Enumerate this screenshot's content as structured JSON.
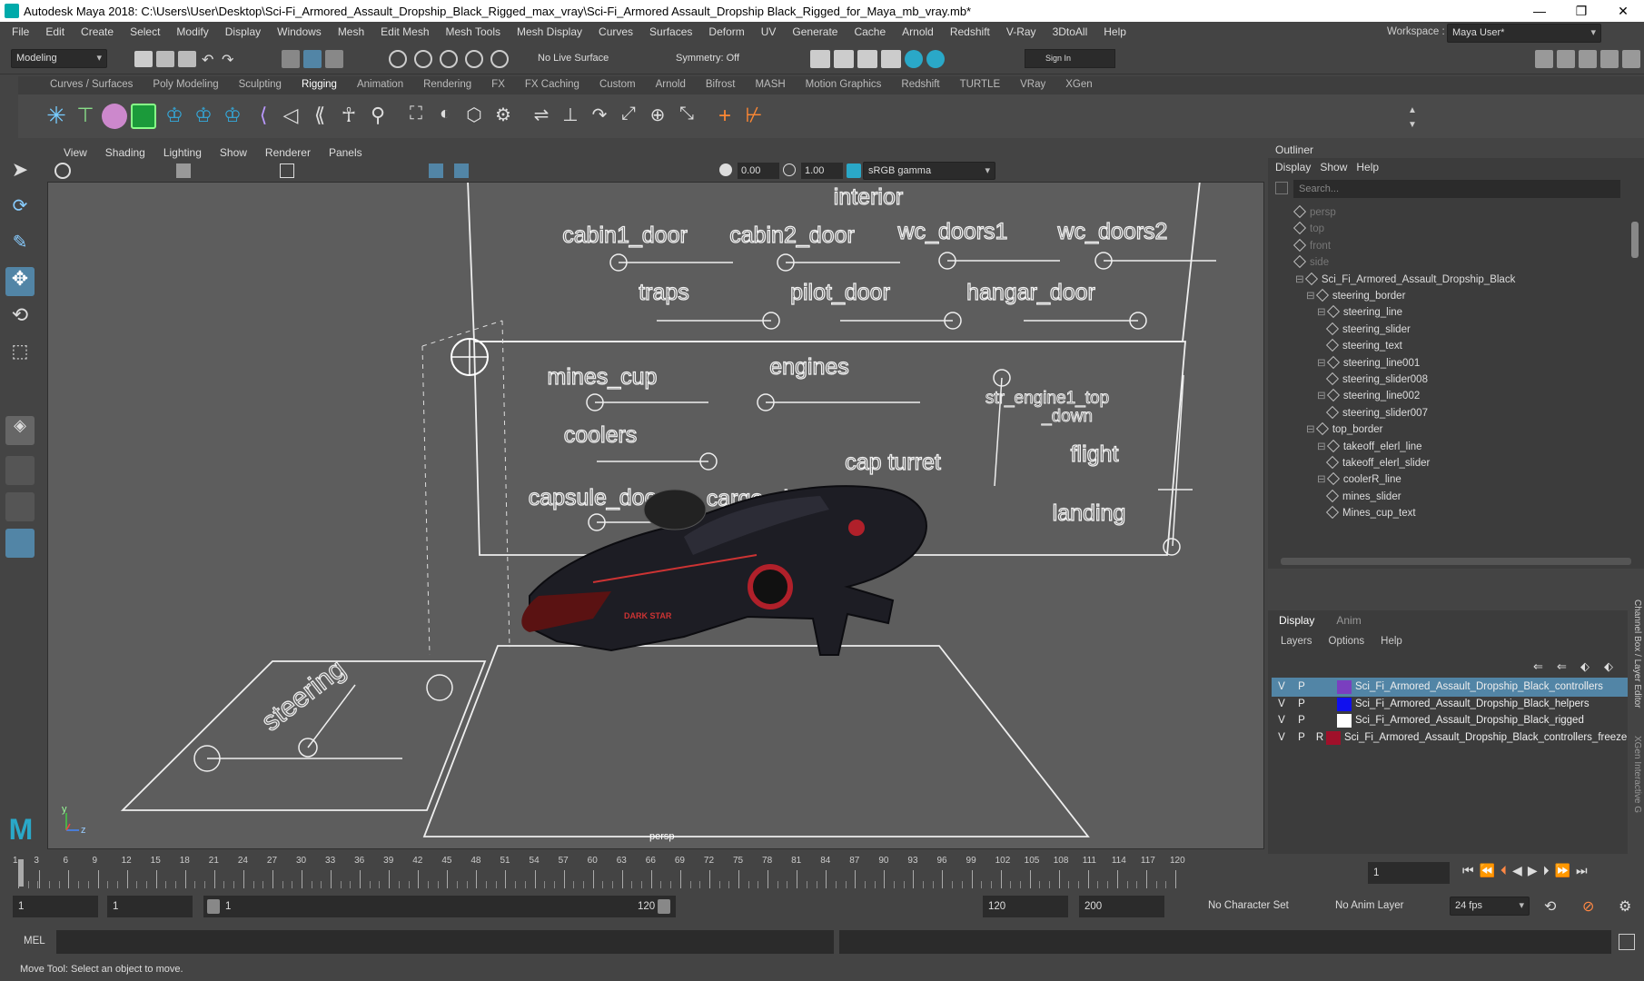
{
  "window": {
    "title": "Autodesk Maya 2018: C:\\Users\\User\\Desktop\\Sci-Fi_Armored_Assault_Dropship_Black_Rigged_max_vray\\Sci-Fi_Armored Assault_Dropship Black_Rigged_for_Maya_mb_vray.mb*",
    "minimize": "—",
    "maximize": "❐",
    "close": "✕"
  },
  "menubar": [
    "File",
    "Edit",
    "Create",
    "Select",
    "Modify",
    "Display",
    "Windows",
    "Mesh",
    "Edit Mesh",
    "Mesh Tools",
    "Mesh Display",
    "Curves",
    "Surfaces",
    "Deform",
    "UV",
    "Generate",
    "Cache",
    "Arnold",
    "Redshift",
    "V-Ray",
    "3DtoAll",
    "Help"
  ],
  "workspace": {
    "label": "Workspace :",
    "value": "Maya User*"
  },
  "statusline": {
    "mode": "Modeling",
    "live_surface": "No Live Surface",
    "symmetry": "Symmetry: Off",
    "sign_in": "Sign In"
  },
  "shelf_tabs": [
    "Curves / Surfaces",
    "Poly Modeling",
    "Sculpting",
    "Rigging",
    "Animation",
    "Rendering",
    "FX",
    "FX Caching",
    "Custom",
    "Arnold",
    "Bifrost",
    "MASH",
    "Motion Graphics",
    "Redshift",
    "TURTLE",
    "VRay",
    "XGen"
  ],
  "active_shelf": "Rigging",
  "viewport": {
    "menus": [
      "View",
      "Shading",
      "Lighting",
      "Show",
      "Renderer",
      "Panels"
    ],
    "exposure": "0.00",
    "gamma": "1.00",
    "color_space": "sRGB gamma",
    "camera_label": "persp",
    "axis_y": "y",
    "axis_z": "z",
    "labels": {
      "interior": "interior",
      "cabin1_door": "cabin1_door",
      "cabin2_door": "cabin2_door",
      "wc_doors1": "wc_doors1",
      "wc_doors2": "wc_doors2",
      "traps": "traps",
      "pilot_door": "pilot_door",
      "hangar_door": "hangar_door",
      "mines_cup": "mines_cup",
      "engines": "engines",
      "coolers": "coolers",
      "capsule_doors": "capsule_doors",
      "cargo_door": "cargo_door",
      "cap_turret": "cap turret",
      "engine_top": "str_engine1_top",
      "engine_top2": "_down",
      "flight": "flight",
      "landing": "landing",
      "steering": "steering",
      "ship_decal": "DARK STAR"
    }
  },
  "outliner": {
    "title": "Outliner",
    "menus": [
      "Display",
      "Show",
      "Help"
    ],
    "search_placeholder": "Search...",
    "items": [
      {
        "label": "persp",
        "dim": true,
        "indent": 0
      },
      {
        "label": "top",
        "dim": true,
        "indent": 0
      },
      {
        "label": "front",
        "dim": true,
        "indent": 0
      },
      {
        "label": "side",
        "dim": true,
        "indent": 0
      },
      {
        "label": "Sci_Fi_Armored_Assault_Dropship_Black",
        "dim": false,
        "indent": 0
      },
      {
        "label": "steering_border",
        "dim": false,
        "indent": 1
      },
      {
        "label": "steering_line",
        "dim": false,
        "indent": 2
      },
      {
        "label": "steering_slider",
        "dim": false,
        "indent": 3
      },
      {
        "label": "steering_text",
        "dim": false,
        "indent": 3
      },
      {
        "label": "steering_line001",
        "dim": false,
        "indent": 2
      },
      {
        "label": "steering_slider008",
        "dim": false,
        "indent": 3
      },
      {
        "label": "steering_line002",
        "dim": false,
        "indent": 2
      },
      {
        "label": "steering_slider007",
        "dim": false,
        "indent": 3
      },
      {
        "label": "top_border",
        "dim": false,
        "indent": 1
      },
      {
        "label": "takeoff_elerl_line",
        "dim": false,
        "indent": 2
      },
      {
        "label": "takeoff_elerl_slider",
        "dim": false,
        "indent": 3
      },
      {
        "label": "coolerR_line",
        "dim": false,
        "indent": 2
      },
      {
        "label": "mines_slider",
        "dim": false,
        "indent": 3
      },
      {
        "label": "Mines_cup_text",
        "dim": false,
        "indent": 3
      }
    ]
  },
  "layer_editor": {
    "tabs": [
      "Display",
      "Anim"
    ],
    "menus": [
      "Layers",
      "Options",
      "Help"
    ],
    "side_label": "Channel Box / Layer Editor",
    "side_label2": "XGen Interactive G",
    "layers": [
      {
        "v": "V",
        "p": "P",
        "r": "",
        "color": "#7a3fbf",
        "name": "Sci_Fi_Armored_Assault_Dropship_Black_controllers",
        "selected": true
      },
      {
        "v": "V",
        "p": "P",
        "r": "",
        "color": "#1010ee",
        "name": "Sci_Fi_Armored_Assault_Dropship_Black_helpers",
        "selected": false
      },
      {
        "v": "V",
        "p": "P",
        "r": "",
        "color": "#ffffff",
        "name": "Sci_Fi_Armored_Assault_Dropship_Black_rigged",
        "selected": false
      },
      {
        "v": "V",
        "p": "P",
        "r": "R",
        "color": "#a0102a",
        "name": "Sci_Fi_Armored_Assault_Dropship_Black_controllers_freeze",
        "selected": false
      }
    ]
  },
  "timeline": {
    "ticks": [
      "1",
      "3",
      "6",
      "9",
      "12",
      "15",
      "18",
      "21",
      "24",
      "27",
      "30",
      "33",
      "36",
      "39",
      "42",
      "45",
      "48",
      "51",
      "54",
      "57",
      "60",
      "63",
      "66",
      "69",
      "72",
      "75",
      "78",
      "81",
      "84",
      "87",
      "90",
      "93",
      "96",
      "99",
      "102",
      "105",
      "108",
      "111",
      "114",
      "117",
      "120"
    ],
    "current_frame": "1"
  },
  "range": {
    "start": "1",
    "playback_start": "1",
    "slider_start": "1",
    "slider_end": "120",
    "playback_end": "120",
    "end": "200",
    "character_set": "No Character Set",
    "anim_layer": "No Anim Layer",
    "fps": "24 fps"
  },
  "command": {
    "label": "MEL"
  },
  "help_line": "Move Tool: Select an object to move."
}
